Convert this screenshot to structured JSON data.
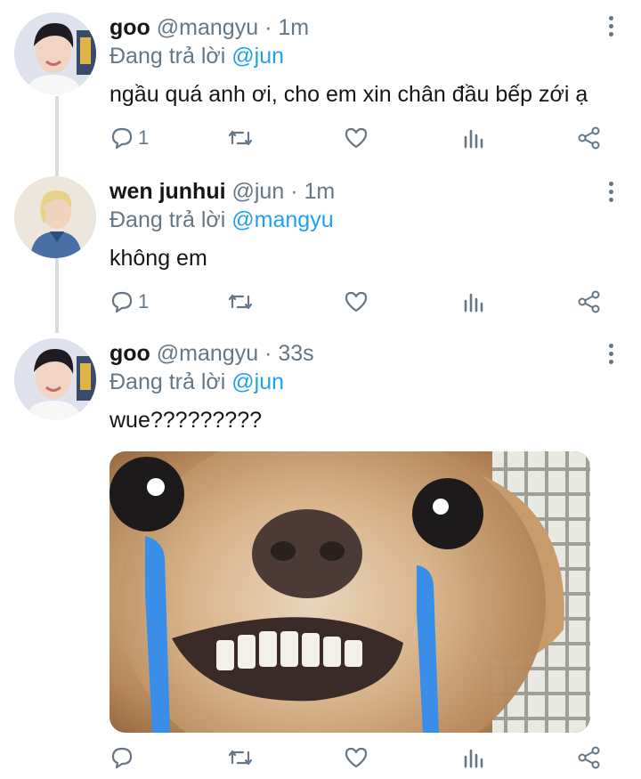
{
  "tweets": [
    {
      "name": "goo",
      "handle": "@mangyu",
      "time": "· 1m",
      "reply_prefix": "Đang trả lời",
      "reply_to": "@jun",
      "text": "ngầu quá anh ơi, cho em xin chân đầu bếp zới ạ",
      "reply_count": "1"
    },
    {
      "name": "wen junhui",
      "handle": "@jun",
      "time": "· 1m",
      "reply_prefix": "Đang trả lời",
      "reply_to": "@mangyu",
      "text": "không em",
      "reply_count": "1"
    },
    {
      "name": "goo",
      "handle": "@mangyu",
      "time": "· 33s",
      "reply_prefix": "Đang trả lời",
      "reply_to": "@jun",
      "text": "wue?????????",
      "reply_count": ""
    }
  ],
  "icons": [
    "reply-icon",
    "retweet-icon",
    "like-icon",
    "analytics-icon",
    "share-icon",
    "more-icon"
  ],
  "colors": {
    "mention": "#1da1f2",
    "secondary": "#657786",
    "thread_line": "#d5dbe0"
  }
}
